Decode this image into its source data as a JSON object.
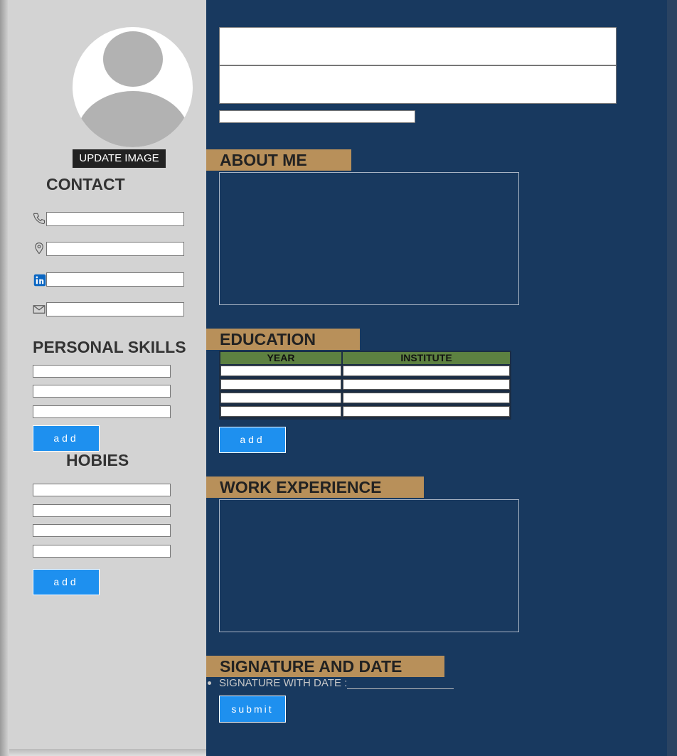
{
  "profile": {
    "update_image_label": "UPDATE IMAGE"
  },
  "contact": {
    "heading": "CONTACT",
    "fields": [
      {
        "icon": "phone-icon",
        "value": ""
      },
      {
        "icon": "location-pin-icon",
        "value": ""
      },
      {
        "icon": "linkedin-icon",
        "value": ""
      },
      {
        "icon": "mail-icon",
        "value": ""
      }
    ]
  },
  "personal_skills": {
    "heading": "PERSONAL SKILLS",
    "inputs": [
      "",
      "",
      ""
    ],
    "add_label": "add"
  },
  "hobbies": {
    "heading": "HOBIES",
    "inputs": [
      "",
      "",
      "",
      ""
    ],
    "add_label": "add"
  },
  "header": {
    "name_value": "",
    "title_value": "",
    "subtitle_value": ""
  },
  "about": {
    "heading": "ABOUT ME",
    "text": ""
  },
  "education": {
    "heading": "EDUCATION",
    "columns": [
      "YEAR",
      "INSTITUTE"
    ],
    "rows": [
      [
        "",
        ""
      ],
      [
        "",
        ""
      ],
      [
        "",
        ""
      ],
      [
        "",
        ""
      ]
    ],
    "add_label": "add"
  },
  "work": {
    "heading": "WORK EXPERIENCE",
    "text": ""
  },
  "signature": {
    "heading": "SIGNATURE AND DATE",
    "label": "SIGNATURE WITH DATE :",
    "submit_label": "submit"
  },
  "colors": {
    "sidebar_bg": "#d3d3d3",
    "main_bg": "#18395f",
    "section_bar": "#b8905a",
    "table_header": "#5d8141",
    "button_blue": "#1e90ef"
  }
}
